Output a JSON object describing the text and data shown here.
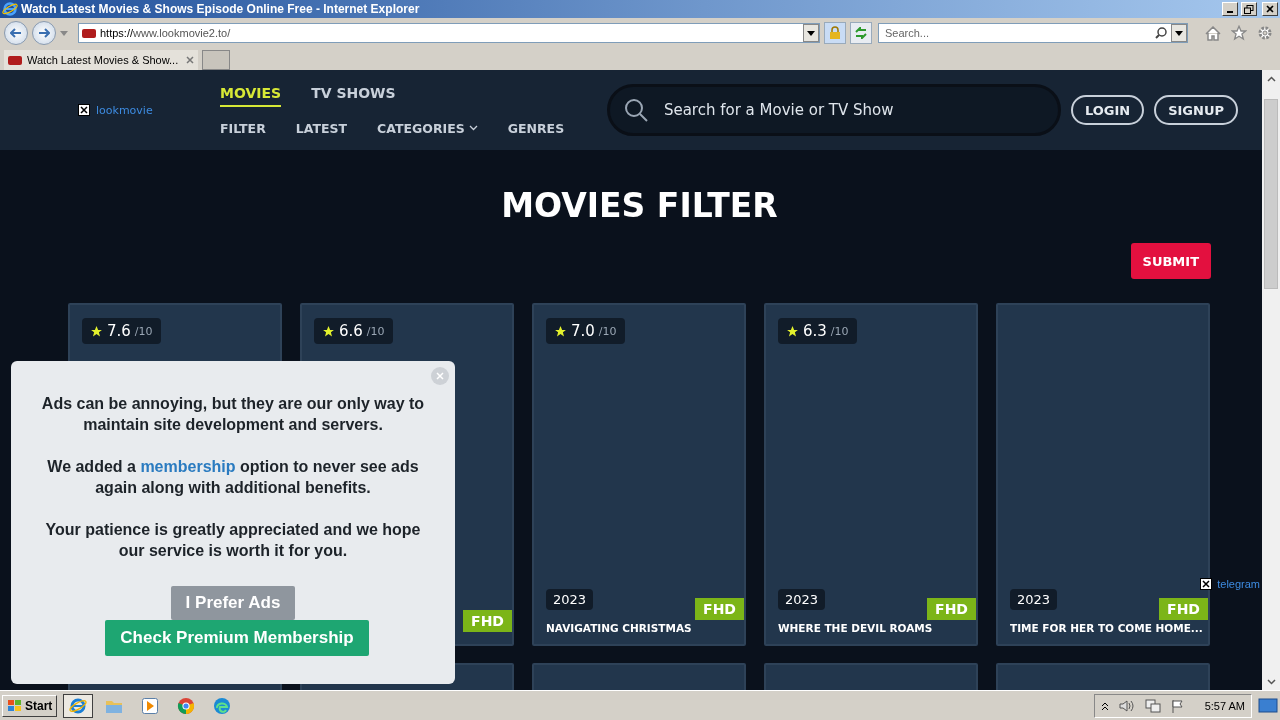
{
  "browser": {
    "title": "Watch Latest Movies & Shows Episode Online Free - Internet Explorer",
    "url_host": "https://",
    "url_rest": "www.lookmovie2.to/",
    "search_placeholder": "Search...",
    "tabs": [
      {
        "label": "Watch Latest Movies & Show...",
        "selected": true
      }
    ]
  },
  "site": {
    "logo": "lookmovie",
    "nav_primary": [
      {
        "label": "MOVIES",
        "selected": true
      },
      {
        "label": "TV SHOWS",
        "selected": false
      }
    ],
    "nav_secondary": [
      {
        "label": "FILTER",
        "dropdown": false
      },
      {
        "label": "LATEST",
        "dropdown": false
      },
      {
        "label": "CATEGORIES",
        "dropdown": true
      },
      {
        "label": "GENRES",
        "dropdown": false
      }
    ],
    "search": {
      "placeholder": "Search for a Movie or TV Show"
    },
    "buttons": [
      "LOGIN",
      "SIGNUP"
    ]
  },
  "page": {
    "heading": "MOVIES FILTER",
    "submit": "SUBMIT"
  },
  "movies": [
    {
      "kind": "movie",
      "rating": "7.6",
      "scale": "/10"
    },
    {
      "kind": "movie",
      "rating": "6.6",
      "scale": "/10",
      "quality": "FHD"
    },
    {
      "kind": "movie",
      "rating": "7.0",
      "scale": "/10",
      "year": "2023",
      "quality": "FHD",
      "title": "NAVIGATING CHRISTMAS"
    },
    {
      "kind": "movie",
      "rating": "6.3",
      "scale": "/10",
      "year": "2023",
      "quality": "FHD",
      "title": "WHERE THE DEVIL ROAMS"
    },
    {
      "kind": "movie",
      "year": "2023",
      "quality": "FHD",
      "title": "TIME FOR HER TO COME HOME..."
    },
    {
      "kind": "covered"
    },
    {
      "kind": "cut"
    },
    {
      "kind": "cut"
    },
    {
      "kind": "cut"
    },
    {
      "kind": "cut"
    }
  ],
  "popup": {
    "paragraphs": [
      [
        {
          "kind": "text",
          "text": "Ads can be annoying, but they are our only way to maintain site development and servers."
        }
      ],
      [
        {
          "kind": "text",
          "text": "We added a "
        },
        {
          "kind": "link",
          "text": "membership"
        },
        {
          "kind": "text",
          "text": " option to never see ads again along with additional benefits."
        }
      ],
      [
        {
          "kind": "text",
          "text": "Your patience is greatly appreciated and we hope our service is worth it for you."
        }
      ]
    ],
    "buttons": [
      {
        "kind": "secondary",
        "label": "I Prefer Ads"
      },
      {
        "kind": "primary",
        "label": "Check Premium Membership"
      }
    ]
  },
  "telegram": {
    "label": "telegram"
  },
  "taskbar": {
    "start": "Start",
    "apps": [
      {
        "kind": "ie",
        "selected": true
      },
      {
        "kind": "folder",
        "selected": false
      },
      {
        "kind": "media",
        "selected": false
      },
      {
        "kind": "chrome",
        "selected": false
      },
      {
        "kind": "edge",
        "selected": false
      }
    ],
    "clock": "5:57 AM"
  }
}
